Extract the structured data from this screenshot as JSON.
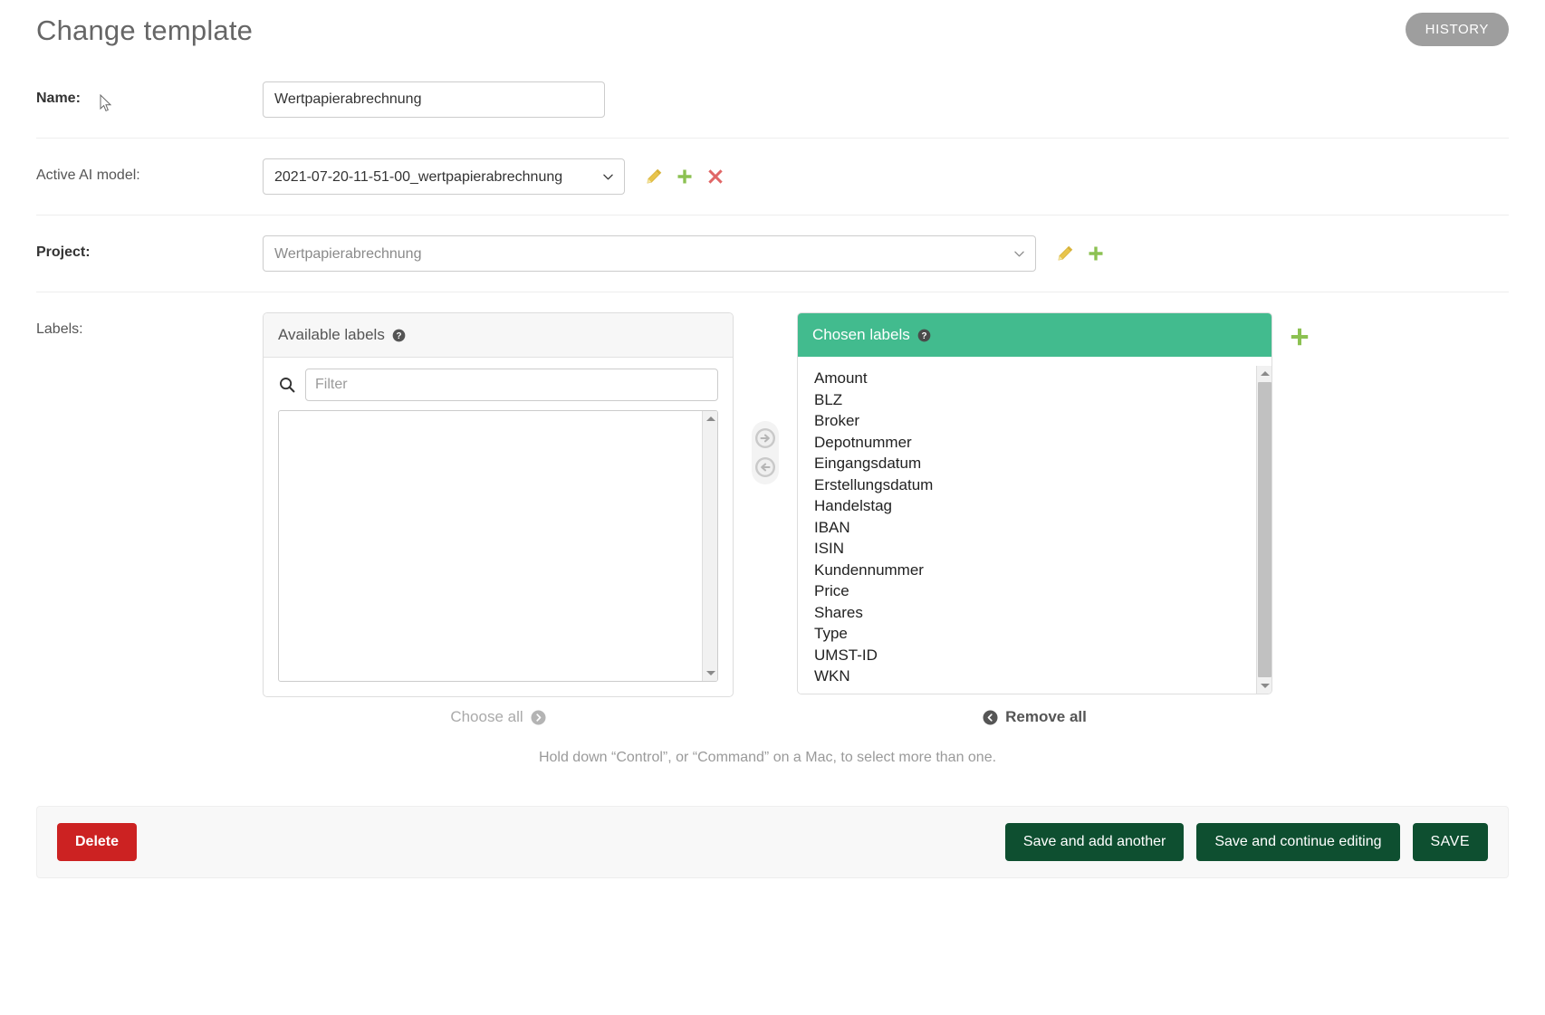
{
  "header": {
    "title": "Change template",
    "history_label": "HISTORY"
  },
  "form": {
    "name": {
      "label": "Name:",
      "value": "Wertpapierabrechnung",
      "placeholder": ""
    },
    "active_ai_model": {
      "label": "Active AI model:",
      "value": "2021-07-20-11-51-00_wertpapierabrechnung",
      "options": [
        "2021-07-20-11-51-00_wertpapierabrechnung"
      ],
      "icons": [
        "pencil-icon",
        "plus-icon",
        "cross-icon"
      ]
    },
    "project": {
      "label": "Project:",
      "value": "Wertpapierabrechnung",
      "options": [
        "Wertpapierabrechnung"
      ],
      "icons": [
        "pencil-icon",
        "plus-icon"
      ]
    },
    "labels": {
      "label": "Labels:",
      "available": {
        "title": "Available labels",
        "help_icon": "question-mark-icon",
        "filter_placeholder": "Filter",
        "filter_value": "",
        "search_icon": "search-icon",
        "items": [],
        "choose_all_label": "Choose all",
        "choose_all_icon": "chevron-right-circle-icon"
      },
      "chosen": {
        "title": "Chosen labels",
        "help_icon": "question-mark-icon",
        "items": [
          "Amount",
          "BLZ",
          "Broker",
          "Depotnummer",
          "Eingangsdatum",
          "Erstellungsdatum",
          "Handelstag",
          "IBAN",
          "ISIN",
          "Kundennummer",
          "Price",
          "Shares",
          "Type",
          "UMST-ID",
          "WKN"
        ],
        "remove_all_label": "Remove all",
        "remove_all_icon": "chevron-left-circle-icon",
        "add_icon": "plus-icon"
      },
      "move_right_icon": "arrow-right-circle-icon",
      "move_left_icon": "arrow-left-circle-icon",
      "hint": "Hold down “Control”, or “Command” on a Mac, to select more than one."
    }
  },
  "footer": {
    "delete_label": "Delete",
    "save_add_another_label": "Save and add another",
    "save_continue_label": "Save and continue editing",
    "save_label": "SAVE"
  },
  "colors": {
    "chosen_header": "#42bb8e",
    "delete": "#cc2222",
    "save": "#0e4f30",
    "history": "#9e9e9e",
    "plus": "#8cc152",
    "pencil": "#e8c44c",
    "cross": "#e06666"
  }
}
